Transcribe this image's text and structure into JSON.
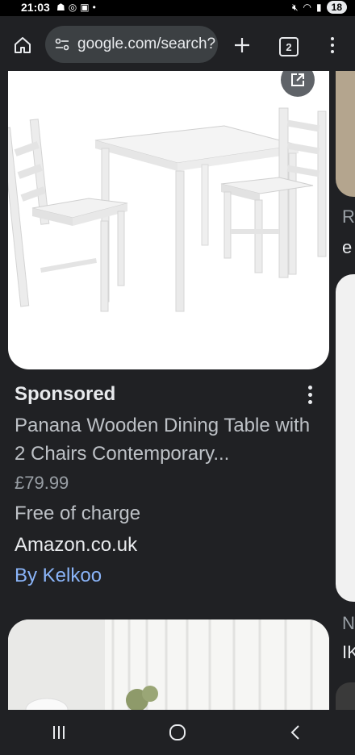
{
  "status_bar": {
    "time": "21:03",
    "battery": "18"
  },
  "toolbar": {
    "url": "google.com/search?",
    "tab_count": "2"
  },
  "product": {
    "label": "Sponsored",
    "title": "Panana Wooden Dining Table with 2 Chairs Contemporary...",
    "price": "£79.99",
    "shipping": "Free of charge",
    "merchant": "Amazon.co.uk",
    "provider": "By Kelkoo"
  },
  "side_cards": {
    "text_1": "R",
    "text_2": "e",
    "text_3": "N",
    "text_4": "IK"
  },
  "colors": {
    "accent_link": "#8ab4f8",
    "background": "#202124"
  },
  "icons": [
    "home-icon",
    "site-settings-icon",
    "plus-icon",
    "tabs-icon",
    "more-vert-icon",
    "open-external-icon",
    "recents-icon",
    "home-nav-icon",
    "back-icon"
  ]
}
